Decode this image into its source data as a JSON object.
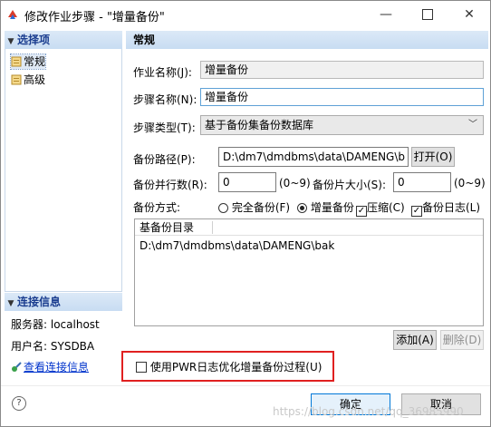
{
  "window": {
    "title": "修改作业步骤 - \"增量备份\"",
    "minimize_glyph": "—",
    "close_glyph": "✕"
  },
  "sidebar": {
    "options_header": "选择项",
    "items": [
      {
        "label": "常规",
        "selected": true
      },
      {
        "label": "高级",
        "selected": false
      }
    ],
    "conn_header": "连接信息",
    "server_label": "服务器:",
    "server_value": "localhost",
    "user_label": "用户名:",
    "user_value": "SYSDBA",
    "view_link": "查看连接信息"
  },
  "main": {
    "header": "常规",
    "job_name_label": "作业名称(J):",
    "job_name_value": "增量备份",
    "step_name_label": "步骤名称(N):",
    "step_name_value": "增量备份",
    "step_type_label": "步骤类型(T):",
    "step_type_value": "基于备份集备份数据库",
    "backup_path_label": "备份路径(P):",
    "backup_path_value": "D:\\dm7\\dmdbms\\data\\DAMENG\\b",
    "open_button": "打开(O)",
    "parallel_label": "备份并行数(R):",
    "parallel_value": "0",
    "parallel_range": "(0~9)",
    "piece_label": "备份片大小(S):",
    "piece_value": "0",
    "piece_range": "(0~9)",
    "mode_label": "备份方式:",
    "mode_full": "完全备份(F)",
    "mode_incr": "增量备份",
    "compress_label": "压缩(C)",
    "backup_log_label": "备份日志(L)",
    "mode_selected": "增量备份",
    "compress_checked": true,
    "backup_log_checked": true,
    "base_dir_header": "基备份目录",
    "base_dirs": [
      "D:\\dm7\\dmdbms\\data\\DAMENG\\bak"
    ],
    "add_button": "添加(A)",
    "delete_button": "删除(D)",
    "pwr_label": "使用PWR日志优化增量备份过程(U)",
    "pwr_checked": false
  },
  "footer": {
    "ok_button": "确定",
    "cancel_button": "取消",
    "watermark": "https://blog.csdn.net/qq_36985990"
  },
  "colors": {
    "accent": "#0078d7",
    "header_bg": "#c8dcf2",
    "highlight_border": "#e02020"
  }
}
